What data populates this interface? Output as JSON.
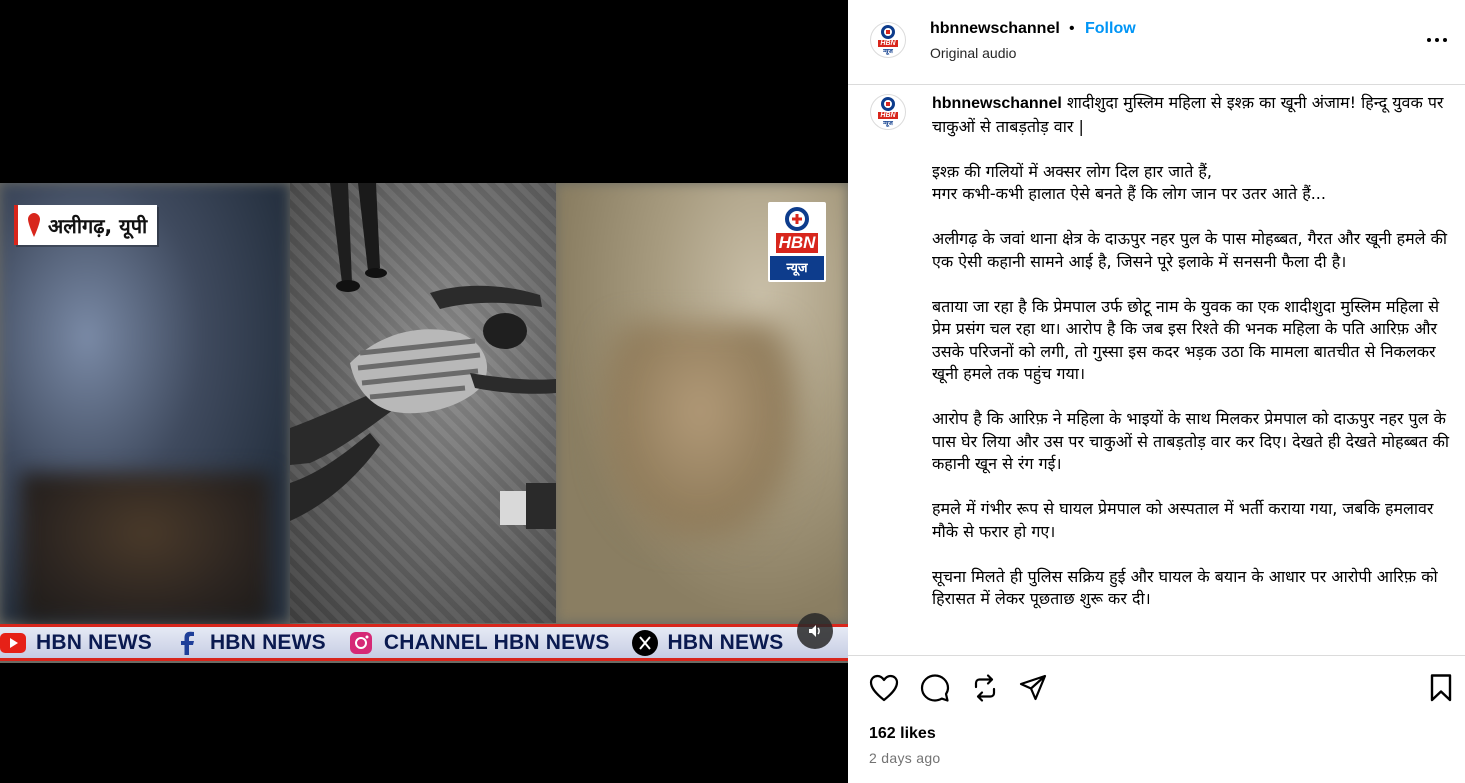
{
  "video": {
    "location_badge": "अलीगढ़, यूपी",
    "logo": {
      "letters": "HBN",
      "sub": "न्यूज"
    },
    "ticker": [
      {
        "icon": "youtube-icon",
        "label": "HBN NEWS"
      },
      {
        "icon": "facebook-icon",
        "label": "HBN NEWS"
      },
      {
        "icon": "instagram-icon",
        "label": "CHANNEL HBN NEWS"
      },
      {
        "icon": "x-icon",
        "label": "HBN NEWS"
      }
    ],
    "mute_icon": "speaker-icon"
  },
  "post": {
    "username": "hbnnewschannel",
    "separator": "•",
    "follow_label": "Follow",
    "audio_label": "Original audio",
    "caption": {
      "username": "hbnnewschannel",
      "headline": "शादीशुदा मुस्लिम महिला से इश्क़ का खूनी अंजाम! हिन्दू युवक पर चाकुओं से ताबड़तोड़ वार |",
      "paragraphs": [
        "इश्क़ की गलियों में अक्सर लोग दिल हार जाते हैं,\nमगर कभी-कभी हालात ऐसे बनते हैं कि लोग जान पर उतर आते हैं...",
        "अलीगढ़ के जवां थाना क्षेत्र के दाऊपुर नहर पुल के पास मोहब्बत, गैरत और खूनी हमले की एक ऐसी कहानी सामने आई है, जिसने पूरे इलाके में सनसनी फैला दी है।",
        "बताया जा रहा है कि प्रेमपाल उर्फ छोटू नाम के युवक का एक शादीशुदा मुस्लिम महिला से प्रेम प्रसंग चल रहा था। आरोप है कि जब इस रिश्ते की भनक महिला के पति आरिफ़ और उसके परिजनों को लगी, तो गुस्सा इस कदर भड़क उठा कि मामला बातचीत से निकलकर खूनी हमले तक पहुंच गया।",
        "आरोप है कि आरिफ़ ने महिला के भाइयों के साथ मिलकर प्रेमपाल को दाऊपुर नहर पुल के पास घेर लिया और उस पर चाकुओं से ताबड़तोड़ वार कर दिए। देखते ही देखते मोहब्बत की कहानी खून से रंग गई।",
        "हमले में गंभीर रूप से घायल प्रेमपाल को अस्पताल में भर्ती कराया गया, जबकि हमलावर मौके से फरार हो गए।",
        "सूचना मिलते ही पुलिस सक्रिय हुई और घायल के बयान के आधार पर आरोपी आरिफ़ को हिरासत में लेकर पूछताछ शुरू कर दी।"
      ]
    },
    "actions": {
      "like_icon": "heart-icon",
      "comment_icon": "comment-icon",
      "repost_icon": "repost-icon",
      "share_icon": "share-icon",
      "save_icon": "bookmark-icon"
    },
    "likes": "162 likes",
    "time_ago": "2 days ago"
  },
  "colors": {
    "accent": "#0095f6",
    "brand_red": "#d8261c",
    "brand_blue": "#0d3c8c",
    "divider": "#dbdbdb"
  }
}
